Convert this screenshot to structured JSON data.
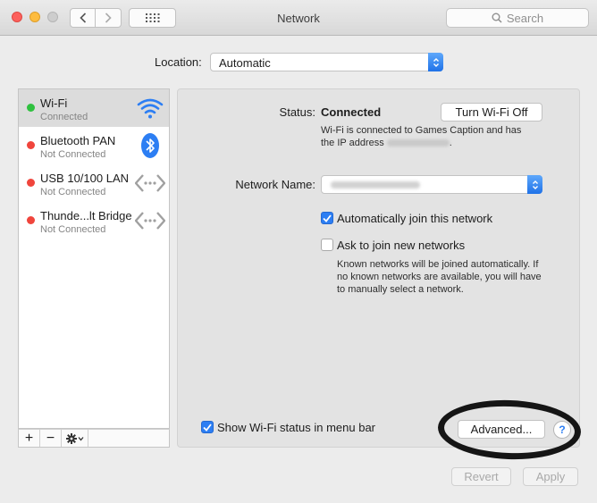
{
  "window": {
    "title": "Network",
    "search_placeholder": "Search"
  },
  "location": {
    "label": "Location:",
    "value": "Automatic"
  },
  "services": [
    {
      "name": "Wi-Fi",
      "status": "Connected",
      "indicator": "green",
      "icon": "wifi-icon",
      "selected": true
    },
    {
      "name": "Bluetooth PAN",
      "status": "Not Connected",
      "indicator": "red",
      "icon": "bluetooth-icon"
    },
    {
      "name": "USB 10/100 LAN",
      "status": "Not Connected",
      "indicator": "red",
      "icon": "ethernet-icon"
    },
    {
      "name": "Thunde...lt Bridge",
      "status": "Not Connected",
      "indicator": "red",
      "icon": "ethernet-icon"
    }
  ],
  "sidebar_toolbar": {
    "add": "+",
    "remove": "−",
    "action": "gear-icon"
  },
  "detail": {
    "status_label": "Status:",
    "status_value": "Connected",
    "turn_off_button": "Turn Wi-Fi Off",
    "status_desc_1": "Wi-Fi is connected to Games Caption and has",
    "status_desc_2": "the IP address",
    "network_name_label": "Network Name:",
    "auto_join_label": "Automatically join this network",
    "auto_join_checked": true,
    "ask_join_label": "Ask to join new networks",
    "ask_join_checked": false,
    "ask_join_desc": [
      "Known networks will be joined automatically. If",
      "no known networks are available, you will have",
      "to manually select a network."
    ],
    "show_status_label": "Show Wi-Fi status in menu bar",
    "show_status_checked": true,
    "advanced_button": "Advanced...",
    "help": "?"
  },
  "footer": {
    "revert_button": "Revert",
    "apply_button": "Apply"
  },
  "colors": {
    "accent": "#2c7ef3",
    "connected": "#2fc13f",
    "not_connected": "#f0453c"
  }
}
